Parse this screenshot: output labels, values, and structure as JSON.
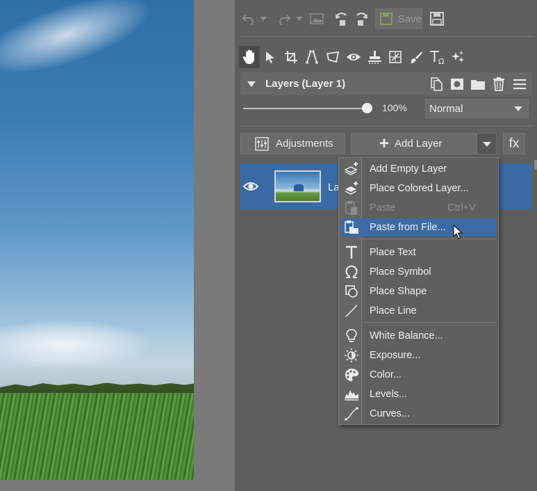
{
  "toolbar": {
    "save_label": "Save"
  },
  "layers_panel": {
    "title": "Layers (Layer 1)",
    "opacity": "100%",
    "opacity_fraction": 1.0,
    "blend_mode": "Normal",
    "adjustments_label": "Adjustments",
    "add_layer_label": "Add Layer",
    "fx_label": "fx",
    "layer": {
      "name": "La"
    }
  },
  "menu": {
    "items": [
      {
        "label": "Add Empty Layer",
        "icon": "add-empty-layer-icon"
      },
      {
        "label": "Place Colored Layer...",
        "icon": "add-colored-layer-icon"
      },
      {
        "label": "Paste",
        "shortcut": "Ctrl+V",
        "icon": "paste-icon",
        "disabled": true
      },
      {
        "label": "Paste from File...",
        "icon": "paste-from-file-icon",
        "highlighted": true
      },
      {
        "label": "Place Text",
        "icon": "text-icon"
      },
      {
        "label": "Place Symbol",
        "icon": "omega-icon"
      },
      {
        "label": "Place Shape",
        "icon": "shape-icon"
      },
      {
        "label": "Place Line",
        "icon": "line-icon"
      },
      {
        "label": "White Balance...",
        "icon": "bulb-icon"
      },
      {
        "label": "Exposure...",
        "icon": "sun-icon"
      },
      {
        "label": "Color...",
        "icon": "palette-icon"
      },
      {
        "label": "Levels...",
        "icon": "levels-icon"
      },
      {
        "label": "Curves...",
        "icon": "curves-icon"
      }
    ]
  },
  "colors": {
    "panel_bg": "#5f5f5f",
    "selection": "#3a6aa5",
    "save_accent": "#7fa05a"
  }
}
